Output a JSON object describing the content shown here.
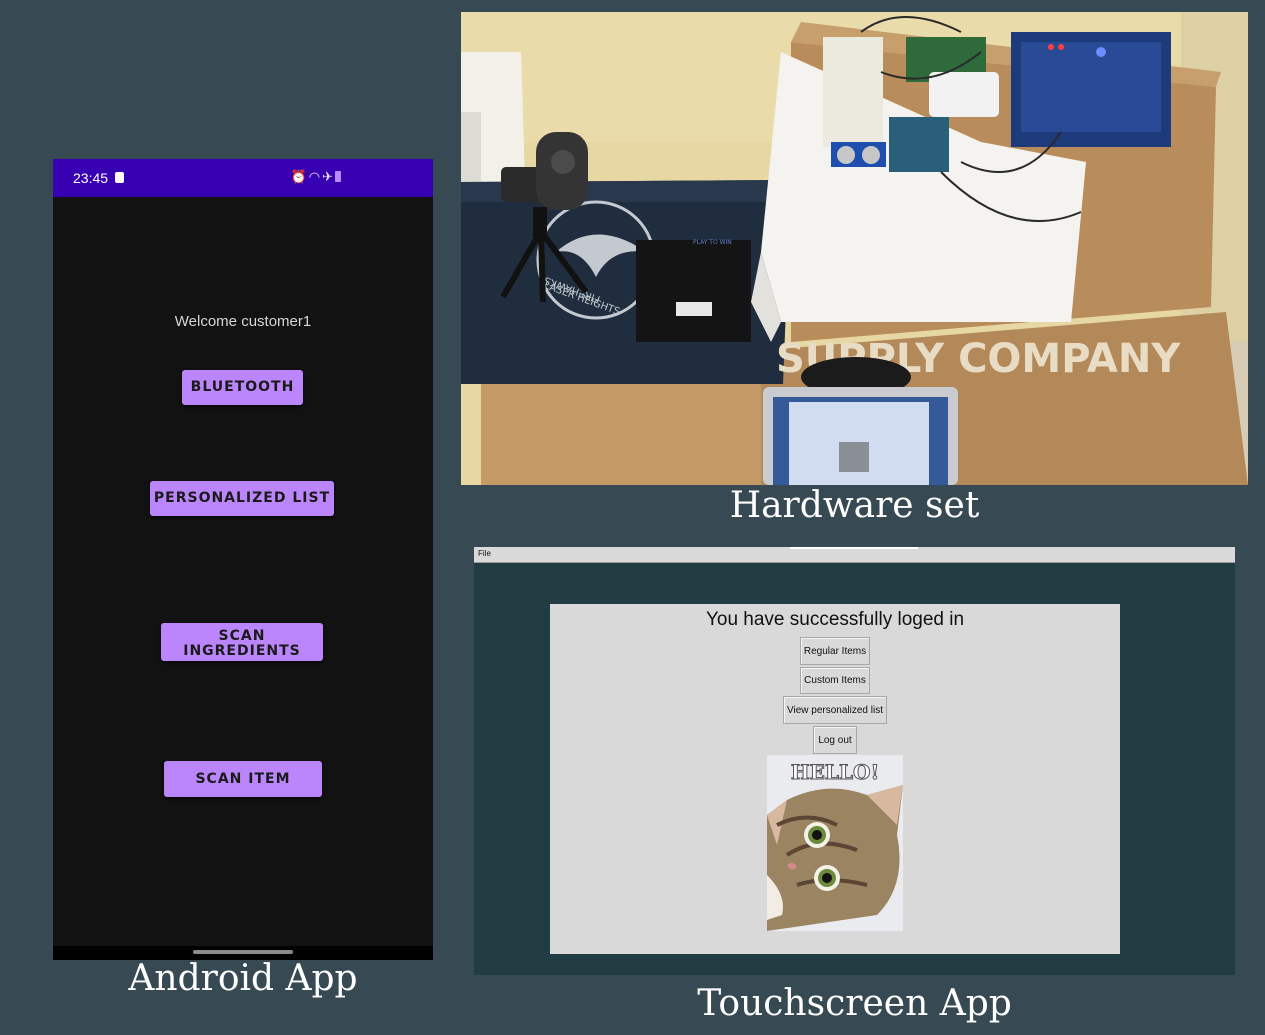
{
  "captions": {
    "android": "Android App",
    "hardware": "Hardware set",
    "touchscreen": "Touchscreen App"
  },
  "android": {
    "status_bar": {
      "time": "23:45",
      "icons": [
        "alarm-icon",
        "wifi-icon",
        "airplane-icon",
        "battery-icon"
      ]
    },
    "welcome": "Welcome customer1",
    "buttons": [
      "BLUETOOTH",
      "PERSONALIZED LIST",
      "SCAN INGREDIENTS",
      "SCAN ITEM"
    ]
  },
  "hardware_photo": {
    "texts": [
      "FIREHAWKS",
      "LASER HEIGHTS",
      "PLAY TO WIN",
      "SUPPLY COMPANY"
    ]
  },
  "touchscreen": {
    "menu": {
      "file": "File"
    },
    "heading": "You have successfully loged in",
    "buttons": [
      "Regular Items",
      "Custom Items",
      "View personalized list",
      "Log out"
    ],
    "image_text": "HELLO!"
  },
  "colors": {
    "background": "#374a53",
    "android_status_bar": "#3700b3",
    "android_button": "#bb86fc",
    "touchscreen_background": "#213c42",
    "touchscreen_panel": "#d9d9d9"
  }
}
